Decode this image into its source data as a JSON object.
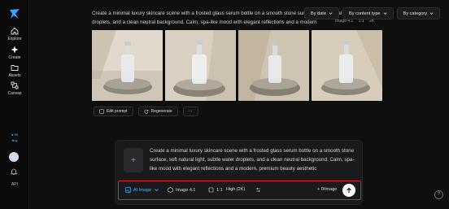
{
  "sidebar": {
    "items": [
      {
        "label": "Explore",
        "icon": "home-icon"
      },
      {
        "label": "Create",
        "icon": "sparkle-icon"
      },
      {
        "label": "Assets",
        "icon": "folder-icon"
      },
      {
        "label": "Canvas",
        "icon": "canvas-icon"
      }
    ],
    "credits_amount": "● 99",
    "credits_label": "Buy",
    "api_label": "API"
  },
  "filters": [
    {
      "label": "By date"
    },
    {
      "label": "By content type"
    },
    {
      "label": "By category"
    }
  ],
  "generation": {
    "prompt": "Create a minimal luxury skincare scene with a frosted glass serum bottle on a smooth stone surface, soft natural light, subtle water droplets, and a clean neutral background. Calm, spa-like mood with elegant reflections and a modern",
    "model": "Image 4.1",
    "ratio": "1:1",
    "quality": "2K"
  },
  "actions": {
    "edit_prompt": "Edit prompt",
    "regenerate": "Regenerate",
    "more": "···"
  },
  "composer": {
    "prompt": "Create a minimal luxury skincare scene with a frosted glass serum bottle on a smooth stone surface, soft natural light, subtle water droplets, and a clean neutral background. Calm, spa-like mood with elegant reflections and a modern, premium beauty aesthetic",
    "mode": "AI Image",
    "model": "Image 4.1",
    "ratio": "1:1",
    "quality": "High (2K)",
    "count": "+ 0/image"
  },
  "colors": {
    "accent": "#4fb8ff",
    "highlight_border": "#d9232d"
  }
}
